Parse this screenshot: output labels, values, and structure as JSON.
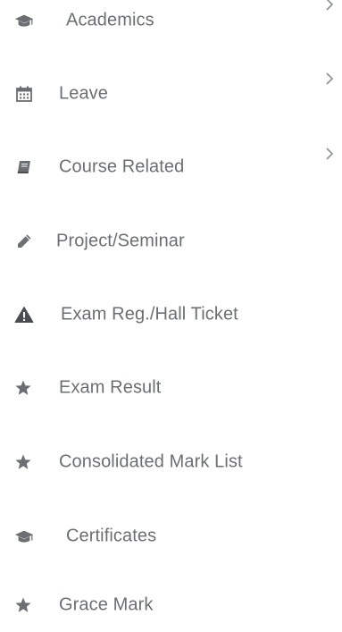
{
  "menu": {
    "items": [
      {
        "label": "Academics",
        "icon": "graduation-cap-icon",
        "has_submenu": true
      },
      {
        "label": "Leave",
        "icon": "calendar-icon",
        "has_submenu": true
      },
      {
        "label": "Course Related",
        "icon": "book-icon",
        "has_submenu": true
      },
      {
        "label": "Project/Seminar",
        "icon": "pencil-icon",
        "has_submenu": false
      },
      {
        "label": "Exam Reg./Hall Ticket",
        "icon": "warning-icon",
        "has_submenu": false
      },
      {
        "label": "Exam Result",
        "icon": "star-icon",
        "has_submenu": false
      },
      {
        "label": "Consolidated Mark List",
        "icon": "star-icon",
        "has_submenu": false
      },
      {
        "label": "Certificates",
        "icon": "graduation-cap-icon",
        "has_submenu": false
      },
      {
        "label": "Grace Mark",
        "icon": "star-icon",
        "has_submenu": false
      }
    ]
  },
  "colors": {
    "text": "#6b6e73",
    "icon": "#6b6e73",
    "icon_dark": "#4a4d52",
    "chevron": "#8a8d92",
    "background": "#ffffff"
  }
}
